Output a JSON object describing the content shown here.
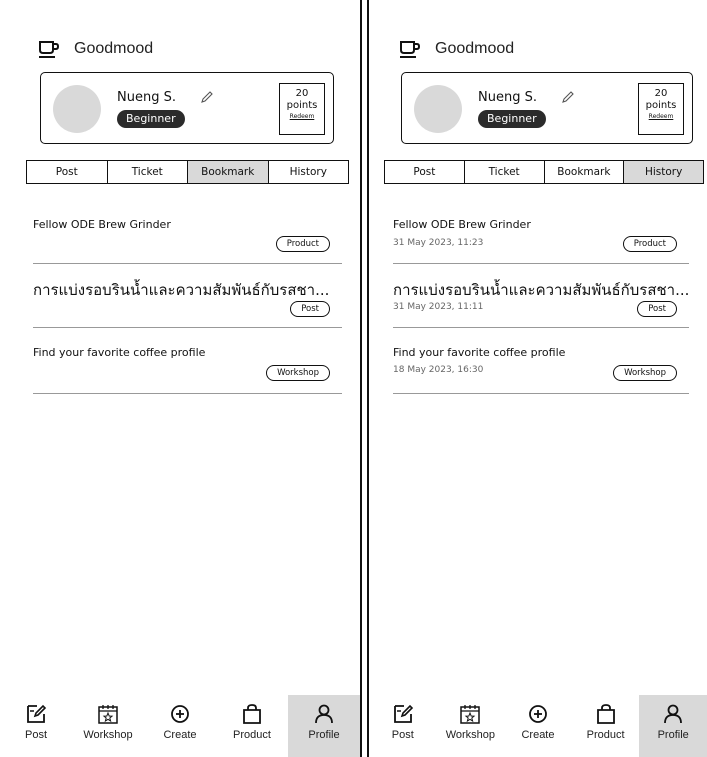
{
  "app_title": "Goodmood",
  "profile": {
    "name": "Nueng S.",
    "level": "Beginner",
    "points_value": "20",
    "points_label": "points",
    "redeem_label": "Redeem"
  },
  "tabs": [
    "Post",
    "Ticket",
    "Bookmark",
    "History"
  ],
  "left_screen": {
    "active_tab": "Bookmark",
    "items": [
      {
        "title": "Fellow ODE Brew Grinder",
        "tag": "Product"
      },
      {
        "title": "การแบ่งรอบรินน้ำและความสัมพันธ์กับรสชา...",
        "tag": "Post"
      },
      {
        "title": "Find your favorite coffee profile",
        "tag": "Workshop"
      }
    ]
  },
  "right_screen": {
    "active_tab": "History",
    "items": [
      {
        "title": "Fellow ODE Brew Grinder",
        "date": "31 May 2023, 11:23",
        "tag": "Product"
      },
      {
        "title": "การแบ่งรอบรินน้ำและความสัมพันธ์กับรสชา...",
        "date": "31 May 2023, 11:11",
        "tag": "Post"
      },
      {
        "title": "Find your favorite coffee profile",
        "date": "18 May 2023, 16:30",
        "tag": "Workshop"
      }
    ]
  },
  "bottom_nav": [
    {
      "label": "Post",
      "icon": "edit-note-icon"
    },
    {
      "label": "Workshop",
      "icon": "calendar-star-icon"
    },
    {
      "label": "Create",
      "icon": "plus-circle-icon"
    },
    {
      "label": "Product",
      "icon": "shopping-bag-icon"
    },
    {
      "label": "Profile",
      "icon": "person-icon",
      "active": true
    }
  ]
}
